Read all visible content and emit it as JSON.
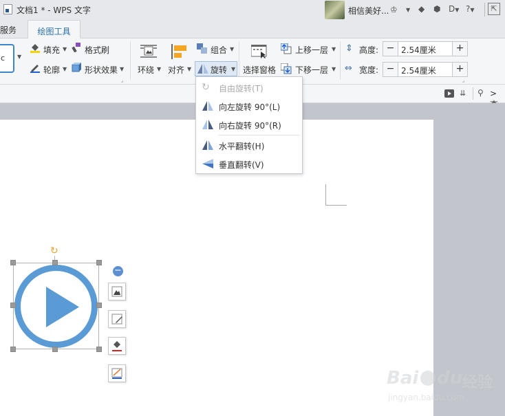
{
  "titlebar": {
    "title": "文档1 * - WPS 文字",
    "username": "相信美好..."
  },
  "tabs": {
    "cloud_service": "云服务",
    "drawing_tools": "绘图工具"
  },
  "ribbon": {
    "fill": "填充",
    "format_painter": "格式刷",
    "outline": "轮廓",
    "shape_effects": "形状效果",
    "wrap": "环绕",
    "align": "对齐",
    "group": "组合",
    "rotate": "旋转",
    "selection_pane": "选择窗格",
    "bring_forward": "上移一层",
    "send_backward": "下移一层",
    "height_label": "高度:",
    "height_value": "2.54厘米",
    "width_label": "宽度:",
    "width_value": "2.54厘米",
    "style_preview": "c"
  },
  "subbar": {
    "find": "查"
  },
  "rotate_menu": {
    "items": [
      {
        "label": "自由旋转(T)",
        "disabled": true
      },
      {
        "label": "向左旋转 90°(L)",
        "disabled": false
      },
      {
        "label": "向右旋转 90°(R)",
        "disabled": false
      },
      {
        "label": "水平翻转(H)",
        "disabled": false
      },
      {
        "label": "垂直翻转(V)",
        "disabled": false
      }
    ]
  },
  "watermark": {
    "brand": "Bai",
    "suffix": "du",
    "cn": "经验",
    "url": "jingyan.baidu.com"
  },
  "colors": {
    "accent": "#3b86c8",
    "shape_fill": "#5b9bd5",
    "handle_orange": "#f0a030"
  }
}
